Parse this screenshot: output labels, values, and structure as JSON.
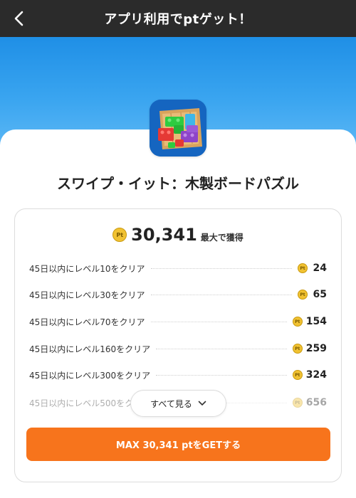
{
  "header": {
    "title": "アプリ利用でptゲット！",
    "back_icon": "chevron-left-icon"
  },
  "app": {
    "name": "スワイプ・イット：木製ボードパズル",
    "icon": "block-puzzle-app-icon"
  },
  "total": {
    "coin": "Pt",
    "value": "30,341",
    "suffix": "最大で獲得"
  },
  "tasks": [
    {
      "label": "45日以内にレベル10をクリア",
      "points": "24"
    },
    {
      "label": "45日以内にレベル30をクリア",
      "points": "65"
    },
    {
      "label": "45日以内にレベル70をクリア",
      "points": "154"
    },
    {
      "label": "45日以内にレベル160をクリア",
      "points": "259"
    },
    {
      "label": "45日以内にレベル300をクリア",
      "points": "324"
    },
    {
      "label": "45日以内にレベル500をクリア",
      "points": "656"
    }
  ],
  "see_all": {
    "label": "すべて見る",
    "icon": "chevron-down-icon"
  },
  "cta": {
    "label": "MAX 30,341 ptをGETする"
  },
  "colors": {
    "header_bg": "#2b2b2b",
    "hero_gradient_top": "#1f8fe6",
    "cta_bg": "#f7741c",
    "coin": "#f1c232"
  }
}
